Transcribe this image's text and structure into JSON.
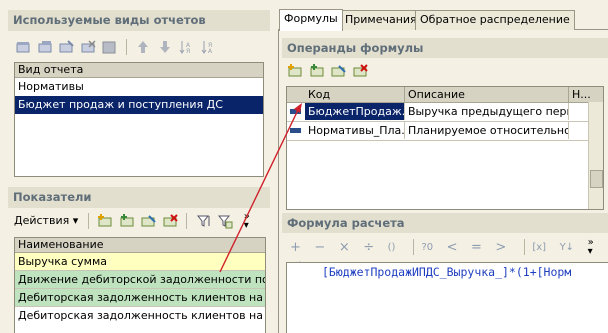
{
  "left": {
    "report_types_title": "Используемые виды отчетов",
    "report_types_header": "Вид отчета",
    "report_types": [
      "Нормативы",
      "Бюджет продаж и поступления ДС"
    ],
    "indicators_title": "Показатели",
    "actions_label": "Действия",
    "indicators_header": "Наименование",
    "indicators": [
      "Выручка сумма",
      "Движение дебиторской задолженности по",
      "Дебиторская задолженность клиентов на к",
      "Дебиторская задолженность клиентов на к"
    ]
  },
  "right": {
    "tabs": [
      "Формулы",
      "Примечания",
      "Обратное распределение"
    ],
    "operands_title": "Операнды формулы",
    "operands_columns": [
      "Код",
      "Описание",
      "Н..."
    ],
    "operands": [
      {
        "code": "БюджетПродаж...",
        "description": "Выручка предыдущего периода"
      },
      {
        "code": "Нормативы_Пла...",
        "description": "Планируемое относительное..."
      }
    ],
    "formula_title": "Формула расчета",
    "formula_text": "[БюджетПродажИПДС_Выручка_]*(1+[Норм"
  },
  "colors": {
    "selection": "#0a246a",
    "indicator_row_highlight": "#ffffc0",
    "indicator_row_green": "#bfe3bf",
    "arrow": "#d0202a",
    "formula_text": "#1f3fc0"
  }
}
